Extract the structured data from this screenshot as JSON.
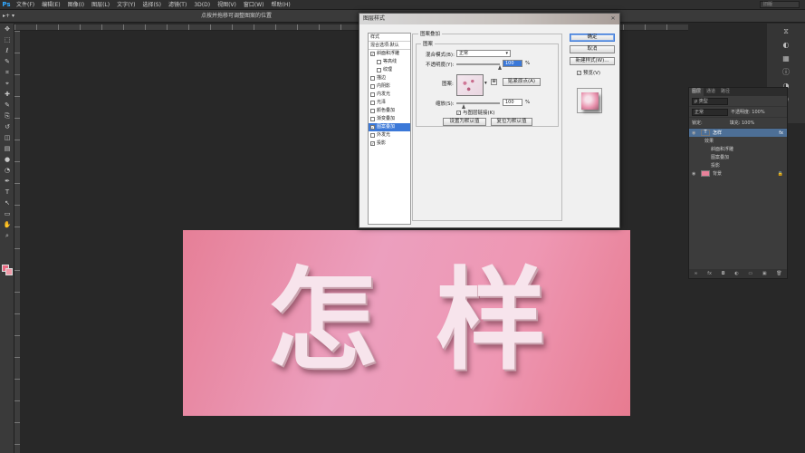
{
  "menubar": {
    "logo": "Ps",
    "items": [
      "文件(F)",
      "编辑(E)",
      "图像(I)",
      "图层(L)",
      "文字(Y)",
      "选择(S)",
      "滤镜(T)",
      "3D(D)",
      "视图(V)",
      "窗口(W)",
      "帮助(H)"
    ],
    "workspace": "旧版"
  },
  "options": {
    "tool_preset": "▸+ ▾",
    "hint": "点按并拖移可调整图案的位置"
  },
  "canvas": {
    "text": "怎样",
    "colors": {
      "bg_start": "#e67f97",
      "bg_mid": "#ec9fbe",
      "text": "#f7e4ec"
    }
  },
  "dialog": {
    "title": "图层样式",
    "styles_header": "样式",
    "blend_options": "混合选项:默认",
    "styles": [
      {
        "label": "斜面和浮雕",
        "checked": true,
        "sub": false
      },
      {
        "label": "等高线",
        "checked": false,
        "sub": true
      },
      {
        "label": "纹理",
        "checked": false,
        "sub": true
      },
      {
        "label": "描边",
        "checked": false,
        "sub": false
      },
      {
        "label": "内阴影",
        "checked": false,
        "sub": false
      },
      {
        "label": "内发光",
        "checked": false,
        "sub": false
      },
      {
        "label": "光泽",
        "checked": false,
        "sub": false
      },
      {
        "label": "颜色叠加",
        "checked": false,
        "sub": false
      },
      {
        "label": "渐变叠加",
        "checked": false,
        "sub": false
      },
      {
        "label": "图案叠加",
        "checked": true,
        "sub": false,
        "selected": true
      },
      {
        "label": "外发光",
        "checked": false,
        "sub": false
      },
      {
        "label": "投影",
        "checked": true,
        "sub": false
      }
    ],
    "group_title": "图案叠加",
    "inner_title": "图案",
    "blend_mode_label": "混合模式(B):",
    "blend_mode_value": "正常",
    "opacity_label": "不透明度(Y):",
    "opacity_value": "100",
    "percent": "%",
    "pattern_label": "图案:",
    "snap_origin": "贴紧原点(A)",
    "scale_label": "缩放(S):",
    "scale_value": "100",
    "link_label": "与图层链接(K)",
    "set_default": "设置为默认值",
    "reset_default": "复位为默认值",
    "ok": "确定",
    "cancel": "取消",
    "new_style": "新建样式(W)...",
    "preview": "预览(V)"
  },
  "layers": {
    "tabs": [
      "图层",
      "通道",
      "路径"
    ],
    "kind": "ρ 类型",
    "blend": "正常",
    "opacity": "不透明度: 100%",
    "lock": "锁定:",
    "fill": "填充: 100%",
    "items": [
      {
        "name": "怎样",
        "selected": true,
        "indent": 0,
        "fx": "fx"
      },
      {
        "name": "效果",
        "selected": false,
        "indent": 1
      },
      {
        "name": "斜面和浮雕",
        "selected": false,
        "indent": 2
      },
      {
        "name": "图案叠加",
        "selected": false,
        "indent": 2
      },
      {
        "name": "投影",
        "selected": false,
        "indent": 2
      },
      {
        "name": "背景",
        "selected": false,
        "indent": 0,
        "lock": true
      }
    ],
    "footer": [
      "∞",
      "fx",
      "◘",
      "◐",
      "▭",
      "▣",
      "🗑"
    ]
  },
  "toolbar_icons": [
    "move-tool-icon",
    "marquee-tool-icon",
    "lasso-tool-icon",
    "quick-select-icon",
    "crop-tool-icon",
    "eyedropper-icon",
    "healing-brush-icon",
    "brush-tool-icon",
    "clone-stamp-icon",
    "history-brush-icon",
    "eraser-icon",
    "gradient-icon",
    "blur-icon",
    "dodge-icon",
    "pen-tool-icon",
    "type-tool-icon",
    "path-select-icon",
    "shape-tool-icon",
    "hand-tool-icon",
    "zoom-tool-icon"
  ]
}
